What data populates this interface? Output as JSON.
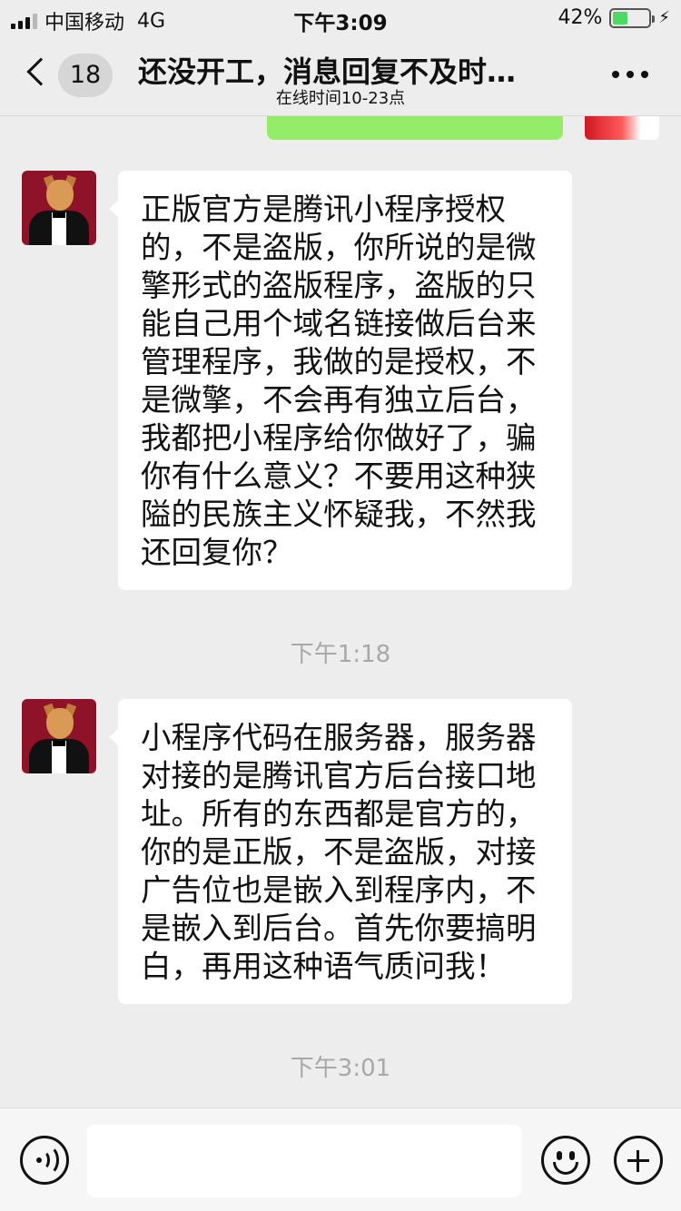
{
  "status_bar": {
    "carrier": "中国移动",
    "network": "4G",
    "time": "下午3:09",
    "battery_percent": "42%",
    "battery_level": 0.42
  },
  "nav": {
    "back_count": "18",
    "title": "还没开工，消息回复不及时…",
    "subtitle": "在线时间10-23点"
  },
  "messages": [
    {
      "sender": "other",
      "text": "正版官方是腾讯小程序授权的，不是盗版，你所说的是微擎形式的盗版程序，盗版的只能自己用个域名链接做后台来管理程序，我做的是授权，不是微擎，不会再有独立后台，我都把小程序给你做好了，骗你有什么意义？不要用这种狭隘的民族主义怀疑我，不然我还回复你？"
    },
    {
      "sender": "other",
      "timestamp": "下午1:18",
      "text": "小程序代码在服务器，服务器对接的是腾讯官方后台接口地址。所有的东西都是官方的，你的是正版，不是盗版，对接广告位也是嵌入到程序内，不是嵌入到后台。首先你要搞明白，再用这种语气质问我！"
    }
  ],
  "trailing_timestamp": "下午3:01",
  "input_bar": {
    "placeholder": ""
  },
  "colors": {
    "background": "#ededed",
    "sent_bubble": "#95ec69",
    "received_bubble": "#ffffff",
    "timestamp": "#a8a8a8"
  }
}
